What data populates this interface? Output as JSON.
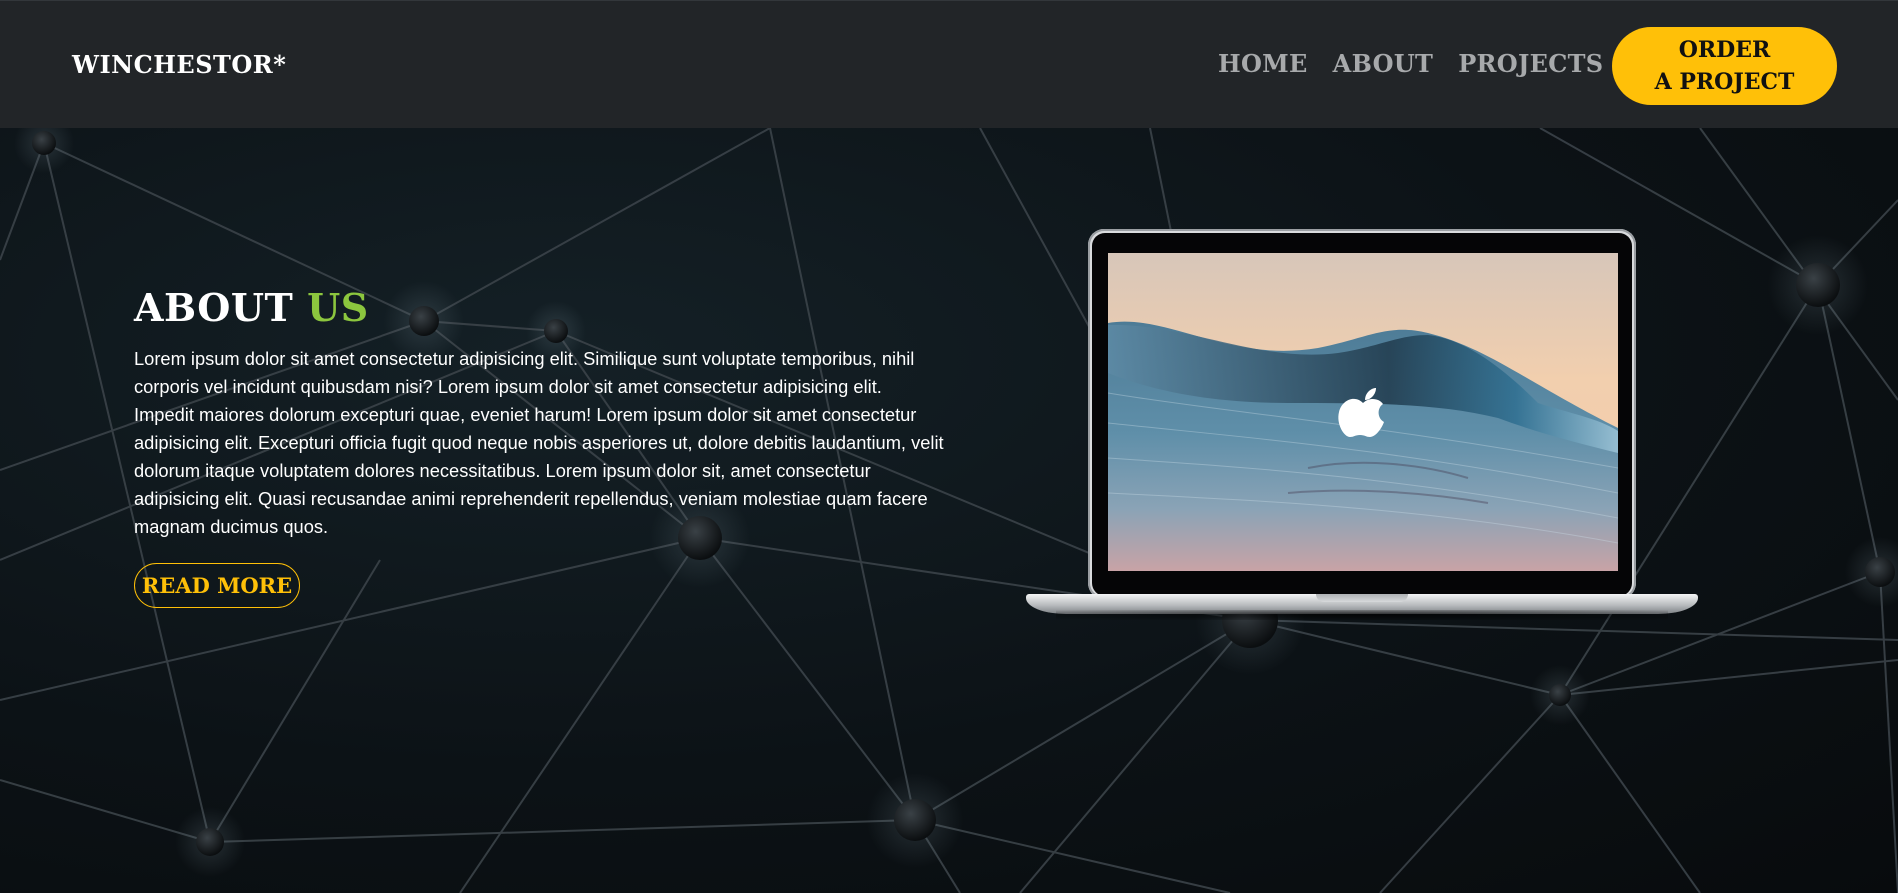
{
  "header": {
    "logo": "WINCHESTOR*",
    "nav": [
      {
        "label": "HOME"
      },
      {
        "label": "ABOUT"
      },
      {
        "label": "PROJECTS"
      }
    ],
    "cta_line1": "ORDER",
    "cta_line2": "A PROJECT"
  },
  "about": {
    "title_main": "ABOUT",
    "title_accent": "US",
    "body": "Lorem ipsum dolor sit amet consectetur adipisicing elit. Similique sunt voluptate temporibus, nihil corporis vel incidunt quibusdam nisi? Lorem ipsum dolor sit amet consectetur adipisicing elit. Impedit maiores dolorum excepturi quae, eveniet harum! Lorem ipsum dolor sit amet consectetur adipisicing elit. Excepturi officia fugit quod neque nobis asperiores ut, dolore debitis laudantium, velit dolorum itaque voluptatem dolores necessitatibus. Lorem ipsum dolor sit, amet consectetur adipisicing elit. Quasi recusandae animi reprehenderit repellendus, veniam molestiae quam facere magnam ducimus quos.",
    "button": "READ MORE"
  },
  "colors": {
    "header_bg": "#222528",
    "accent_yellow": "#ffc008",
    "accent_green": "#8cc63e",
    "nav_text": "#a7a9ab"
  },
  "icons": {
    "laptop_image": "macbook-laptop",
    "screen_logo": "apple-icon"
  }
}
